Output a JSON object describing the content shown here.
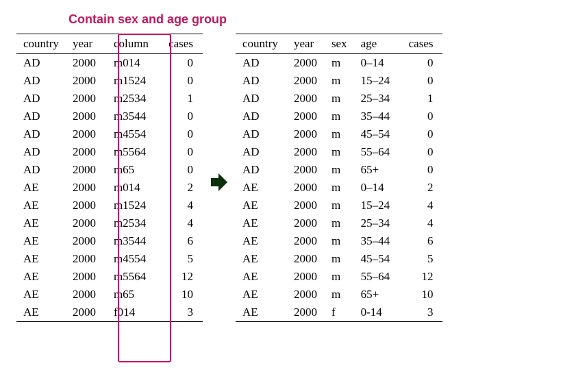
{
  "caption": "Contain sex and age group",
  "left": {
    "headers": {
      "c0": "country",
      "c1": "year",
      "c2": "column",
      "c3": "cases"
    },
    "rows": [
      {
        "country": "AD",
        "year": "2000",
        "column": "m014",
        "cases": "0"
      },
      {
        "country": "AD",
        "year": "2000",
        "column": "m1524",
        "cases": "0"
      },
      {
        "country": "AD",
        "year": "2000",
        "column": "m2534",
        "cases": "1"
      },
      {
        "country": "AD",
        "year": "2000",
        "column": "m3544",
        "cases": "0"
      },
      {
        "country": "AD",
        "year": "2000",
        "column": "m4554",
        "cases": "0"
      },
      {
        "country": "AD",
        "year": "2000",
        "column": "m5564",
        "cases": "0"
      },
      {
        "country": "AD",
        "year": "2000",
        "column": "m65",
        "cases": "0"
      },
      {
        "country": "AE",
        "year": "2000",
        "column": "m014",
        "cases": "2"
      },
      {
        "country": "AE",
        "year": "2000",
        "column": "m1524",
        "cases": "4"
      },
      {
        "country": "AE",
        "year": "2000",
        "column": "m2534",
        "cases": "4"
      },
      {
        "country": "AE",
        "year": "2000",
        "column": "m3544",
        "cases": "6"
      },
      {
        "country": "AE",
        "year": "2000",
        "column": "m4554",
        "cases": "5"
      },
      {
        "country": "AE",
        "year": "2000",
        "column": "m5564",
        "cases": "12"
      },
      {
        "country": "AE",
        "year": "2000",
        "column": "m65",
        "cases": "10"
      },
      {
        "country": "AE",
        "year": "2000",
        "column": "f014",
        "cases": "3"
      }
    ]
  },
  "right": {
    "headers": {
      "c0": "country",
      "c1": "year",
      "c2": "sex",
      "c3": "age",
      "c4": "cases"
    },
    "rows": [
      {
        "country": "AD",
        "year": "2000",
        "sex": "m",
        "age": "0–14",
        "cases": "0"
      },
      {
        "country": "AD",
        "year": "2000",
        "sex": "m",
        "age": "15–24",
        "cases": "0"
      },
      {
        "country": "AD",
        "year": "2000",
        "sex": "m",
        "age": "25–34",
        "cases": "1"
      },
      {
        "country": "AD",
        "year": "2000",
        "sex": "m",
        "age": "35–44",
        "cases": "0"
      },
      {
        "country": "AD",
        "year": "2000",
        "sex": "m",
        "age": "45–54",
        "cases": "0"
      },
      {
        "country": "AD",
        "year": "2000",
        "sex": "m",
        "age": "55–64",
        "cases": "0"
      },
      {
        "country": "AD",
        "year": "2000",
        "sex": "m",
        "age": "65+",
        "cases": "0"
      },
      {
        "country": "AE",
        "year": "2000",
        "sex": "m",
        "age": "0–14",
        "cases": "2"
      },
      {
        "country": "AE",
        "year": "2000",
        "sex": "m",
        "age": "15–24",
        "cases": "4"
      },
      {
        "country": "AE",
        "year": "2000",
        "sex": "m",
        "age": "25–34",
        "cases": "4"
      },
      {
        "country": "AE",
        "year": "2000",
        "sex": "m",
        "age": "35–44",
        "cases": "6"
      },
      {
        "country": "AE",
        "year": "2000",
        "sex": "m",
        "age": "45–54",
        "cases": "5"
      },
      {
        "country": "AE",
        "year": "2000",
        "sex": "m",
        "age": "55–64",
        "cases": "12"
      },
      {
        "country": "AE",
        "year": "2000",
        "sex": "m",
        "age": "65+",
        "cases": "10"
      },
      {
        "country": "AE",
        "year": "2000",
        "sex": "f",
        "age": "0-14",
        "cases": "3"
      }
    ]
  }
}
